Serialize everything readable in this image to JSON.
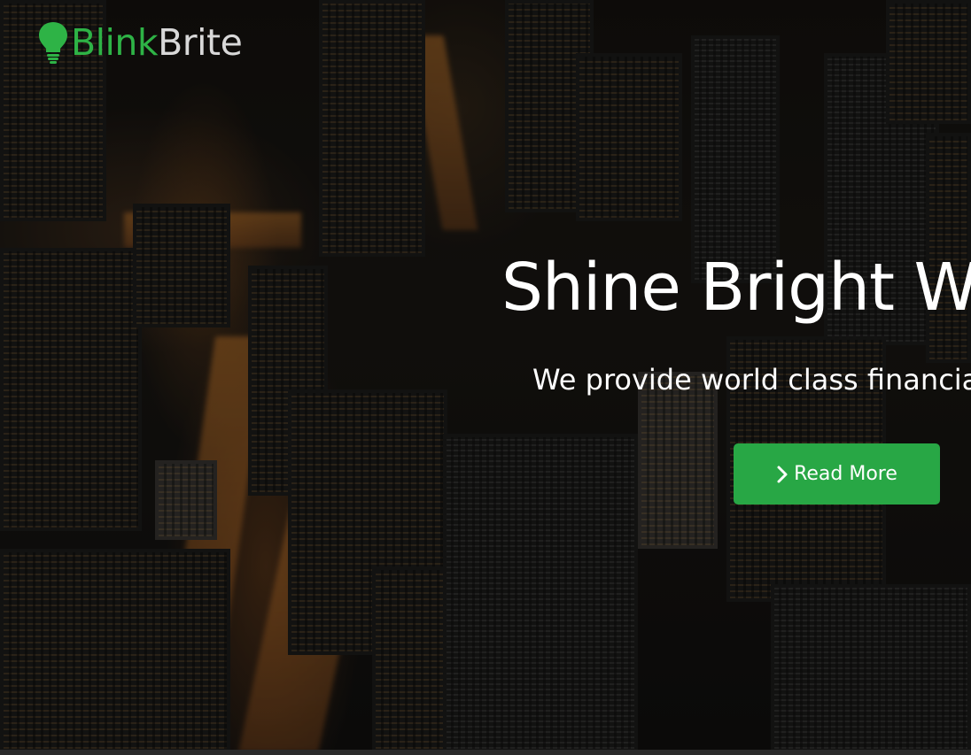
{
  "brand": {
    "name_part1": "Blink",
    "name_part2": "Brite",
    "icon": "lightbulb-icon",
    "accent_color": "#28a745"
  },
  "hero": {
    "headline": "Shine Bright W",
    "subline": "We provide world class financia",
    "cta": {
      "label": "Read More",
      "icon": "chevron-right-icon"
    },
    "background": "night city aerial photo"
  }
}
